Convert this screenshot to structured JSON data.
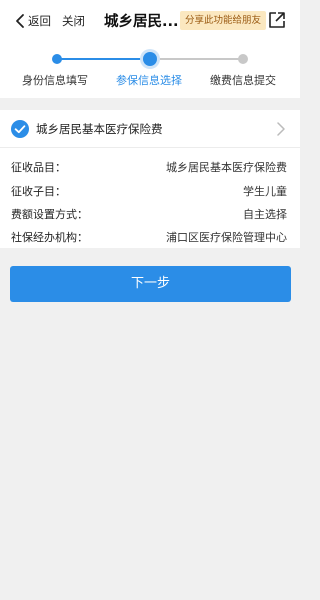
{
  "header": {
    "back_label": "返回",
    "close_label": "关闭",
    "title": "城乡居民...",
    "share_label": "分享此功能给朋友"
  },
  "steps": {
    "items": [
      {
        "label": "身份信息填写",
        "state": "done"
      },
      {
        "label": "参保信息选择",
        "state": "current"
      },
      {
        "label": "缴费信息提交",
        "state": "pending"
      }
    ]
  },
  "insurance": {
    "name": "城乡居民基本医疗保险费",
    "selected": true
  },
  "info": {
    "rows": [
      {
        "label": "征收品目：",
        "value": "城乡居民基本医疗保险费"
      },
      {
        "label": "征收子目：",
        "value": "学生儿童"
      },
      {
        "label": "费额设置方式：",
        "value": "自主选择"
      },
      {
        "label": "社保经办机构：",
        "value": "浦口区医疗保险管理中心"
      }
    ]
  },
  "actions": {
    "next_label": "下一步"
  },
  "colors": {
    "accent": "#2b8de7",
    "share_bg": "#fbe8c0",
    "share_text": "#9a5a12",
    "step_pending": "#c8c8c8"
  }
}
